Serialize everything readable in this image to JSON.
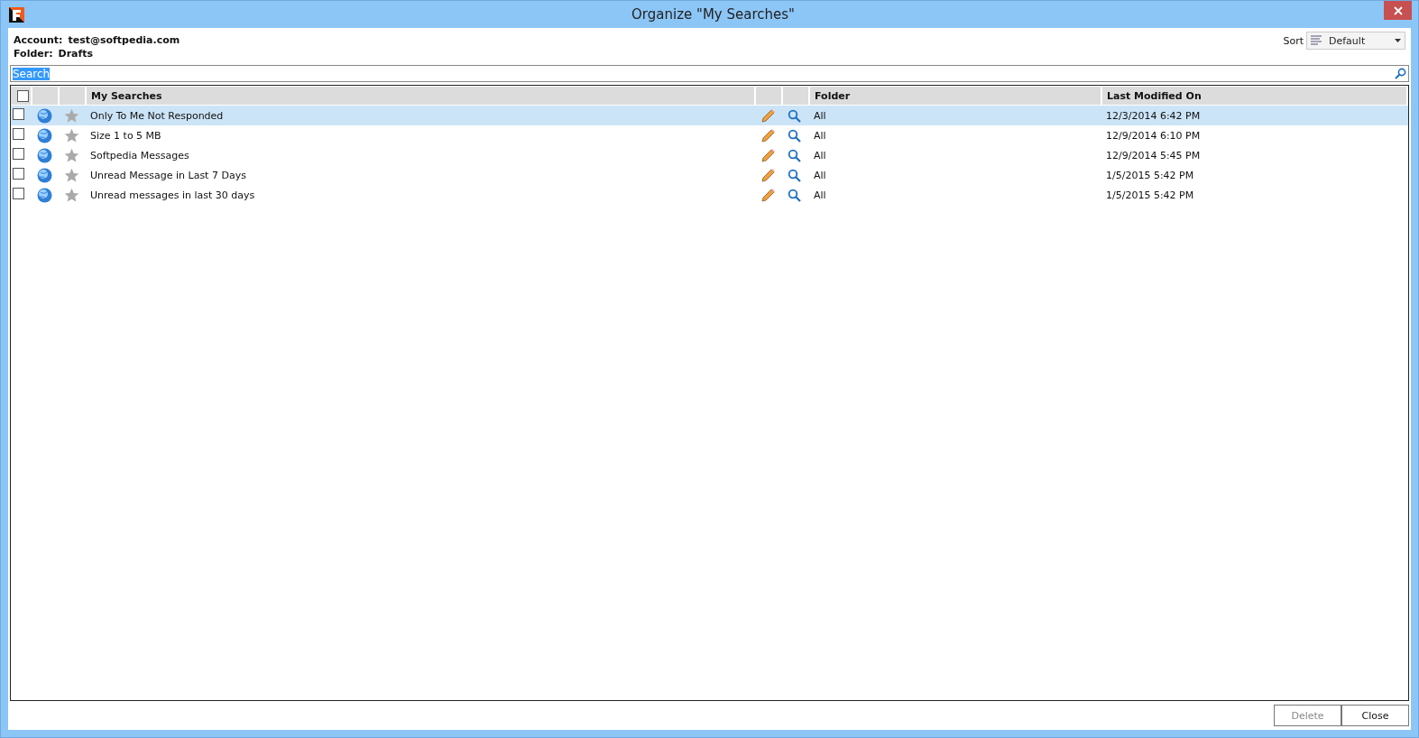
{
  "window": {
    "title": "Organize \"My Searches\""
  },
  "account": {
    "label": "Account:",
    "value": "test@softpedia.com"
  },
  "folder": {
    "label": "Folder:",
    "value": "Drafts"
  },
  "sort": {
    "label": "Sort",
    "value": "Default"
  },
  "search": {
    "value": "Search"
  },
  "table": {
    "all_checked": false,
    "columns": [
      "My Searches",
      "Folder",
      "Last Modified On"
    ],
    "rows": [
      {
        "name": "Only To Me Not Responded",
        "folder": "All",
        "modified": "12/3/2014 6:42 PM",
        "selected": true,
        "checked": false
      },
      {
        "name": "Size 1 to 5 MB",
        "folder": "All",
        "modified": "12/9/2014 6:10 PM",
        "selected": false,
        "checked": false
      },
      {
        "name": "Softpedia Messages",
        "folder": "All",
        "modified": "12/9/2014 5:45 PM",
        "selected": false,
        "checked": false
      },
      {
        "name": "Unread Message in Last 7 Days",
        "folder": "All",
        "modified": "1/5/2015 5:42 PM",
        "selected": false,
        "checked": false
      },
      {
        "name": "Unread messages in last 30 days",
        "folder": "All",
        "modified": "1/5/2015 5:42 PM",
        "selected": false,
        "checked": false
      }
    ]
  },
  "buttons": [
    {
      "label": "Delete",
      "disabled": true
    },
    {
      "label": "Close",
      "disabled": false
    }
  ]
}
